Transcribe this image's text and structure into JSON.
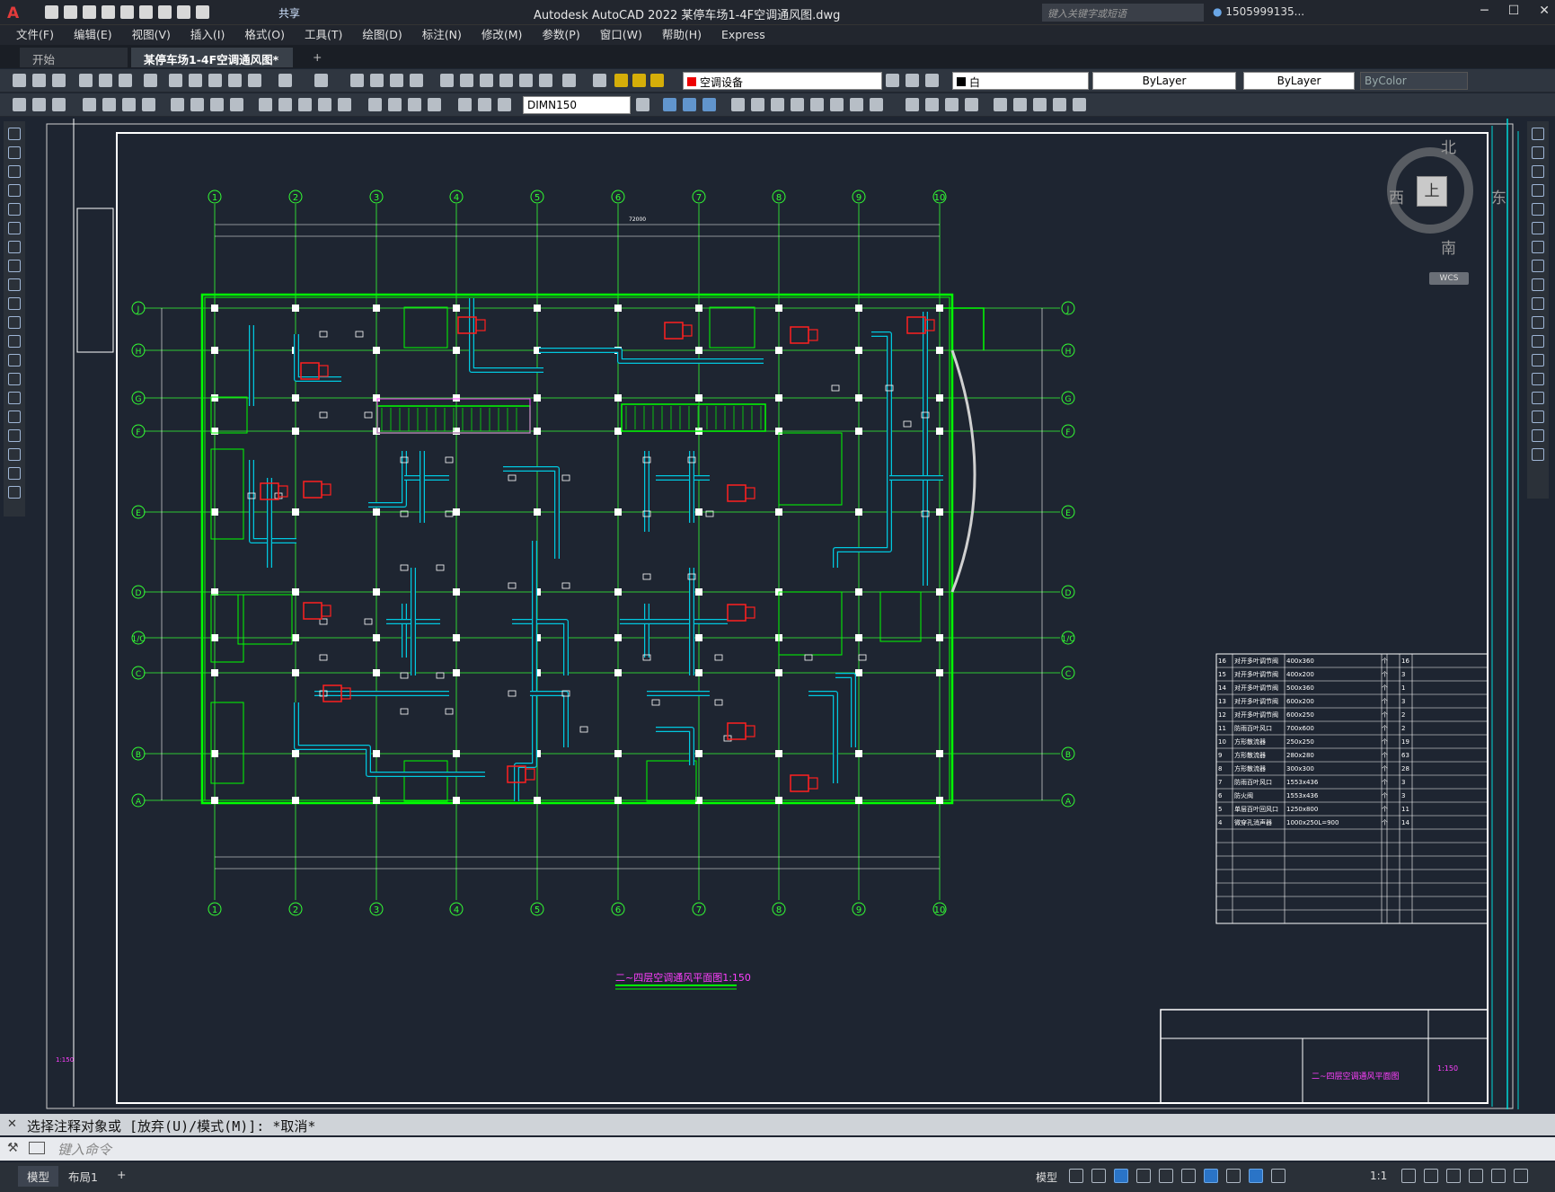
{
  "app": {
    "title": "Autodesk AutoCAD 2022     某停车场1-4F空调通风图.dwg",
    "share": "共享",
    "search_placeholder": "键入关键字或短语",
    "user": "1505999135..."
  },
  "menu": [
    "文件(F)",
    "编辑(E)",
    "视图(V)",
    "插入(I)",
    "格式(O)",
    "工具(T)",
    "绘图(D)",
    "标注(N)",
    "修改(M)",
    "参数(P)",
    "窗口(W)",
    "帮助(H)",
    "Express"
  ],
  "tabs": {
    "start": "开始",
    "doc": "某停车场1-4F空调通风图*"
  },
  "toolbar": {
    "layer": "空调设备",
    "color": "白",
    "linetype": "ByLayer",
    "lineweight": "ByLayer",
    "plotstyle": "ByColor",
    "dimstyle": "DIMN150"
  },
  "viewcube": {
    "north": "北",
    "south": "南",
    "west": "西",
    "east": "东",
    "top": "上",
    "wcs": "WCS"
  },
  "drawing": {
    "col_labels": [
      "1",
      "2",
      "3",
      "4",
      "5",
      "6",
      "7",
      "8",
      "9",
      "10"
    ],
    "row_labels": [
      "J",
      "H",
      "G",
      "F",
      "E",
      "D",
      "1/C",
      "C",
      "B",
      "A"
    ],
    "overall_dim": "72000",
    "caption": "二~四层空调通风平面图1:150",
    "title_block_name": "二~四层空调通风平面图",
    "scale_note": "1:150"
  },
  "equipment_table": [
    {
      "no": "16",
      "name": "对开多叶调节阀",
      "spec": "400x360",
      "unit": "个",
      "qty": "16"
    },
    {
      "no": "15",
      "name": "对开多叶调节阀",
      "spec": "400x200",
      "unit": "个",
      "qty": "3"
    },
    {
      "no": "14",
      "name": "对开多叶调节阀",
      "spec": "500x360",
      "unit": "个",
      "qty": "1"
    },
    {
      "no": "13",
      "name": "对开多叶调节阀",
      "spec": "600x200",
      "unit": "个",
      "qty": "3"
    },
    {
      "no": "12",
      "name": "对开多叶调节阀",
      "spec": "600x250",
      "unit": "个",
      "qty": "2"
    },
    {
      "no": "11",
      "name": "防雨百叶风口",
      "spec": "700x600",
      "unit": "个",
      "qty": "2"
    },
    {
      "no": "10",
      "name": "方形散流器",
      "spec": "250x250",
      "unit": "个",
      "qty": "19"
    },
    {
      "no": "9",
      "name": "方形散流器",
      "spec": "280x280",
      "unit": "个",
      "qty": "63"
    },
    {
      "no": "8",
      "name": "方形散流器",
      "spec": "300x300",
      "unit": "个",
      "qty": "28"
    },
    {
      "no": "7",
      "name": "防雨百叶风口",
      "spec": "1553x436",
      "unit": "个",
      "qty": "3"
    },
    {
      "no": "6",
      "name": "防火阀",
      "spec": "1553x436",
      "unit": "个",
      "qty": "3"
    },
    {
      "no": "5",
      "name": "单层百叶回风口",
      "spec": "1250x800",
      "unit": "个",
      "qty": "11"
    },
    {
      "no": "4",
      "name": "微穿孔消声器",
      "spec": "1000x250L=900",
      "unit": "个",
      "qty": "14"
    }
  ],
  "command": {
    "output": "选择注释对象或 [放弃(U)/模式(M)]: *取消*",
    "placeholder": "键入命令"
  },
  "status": {
    "model_tab": "模型",
    "layout_tab": "布局1",
    "model_label": "模型",
    "scale": "1:1"
  }
}
